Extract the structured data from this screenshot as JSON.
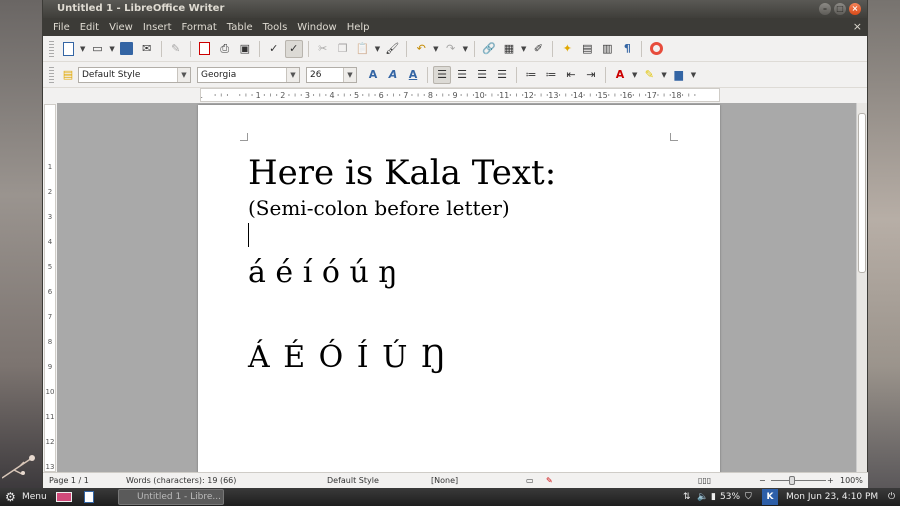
{
  "window": {
    "title": "Untitled 1 - LibreOffice Writer",
    "min_glyph": "–",
    "max_glyph": "□",
    "close_glyph": "×"
  },
  "menu": {
    "items": [
      "File",
      "Edit",
      "View",
      "Insert",
      "Format",
      "Table",
      "Tools",
      "Window",
      "Help"
    ],
    "doc_close": "×"
  },
  "format_bar": {
    "style": "Default Style",
    "font": "Georgia",
    "size": "26"
  },
  "ruler": {
    "numbers": [
      "1",
      "1",
      "2",
      "3",
      "4",
      "5",
      "6",
      "7",
      "8",
      "9",
      "10",
      "11",
      "12",
      "13",
      "14",
      "15",
      "16",
      "17",
      "18"
    ]
  },
  "vruler": {
    "numbers": [
      "1",
      "2",
      "3",
      "4",
      "5",
      "6",
      "7",
      "8",
      "9",
      "10",
      "11",
      "12",
      "13"
    ]
  },
  "document": {
    "line1": "Here is Kala Text:",
    "line2": "(Semi-colon before letter)",
    "line3": "á é í ó ú ŋ",
    "line4": "Á É Ó Í Ú Ŋ"
  },
  "status": {
    "page": "Page 1 / 1",
    "words": "Words (characters): 19 (66)",
    "style": "Default Style",
    "lang": "[None]",
    "zoom": "100%"
  },
  "taskbar": {
    "menu": "Menu",
    "task": "Untitled 1 - Libre...",
    "battery": "53%",
    "datetime": "Mon Jun 23,  4:10 PM"
  },
  "colors": {
    "accent": "#3465a4",
    "close": "#e05a24"
  }
}
